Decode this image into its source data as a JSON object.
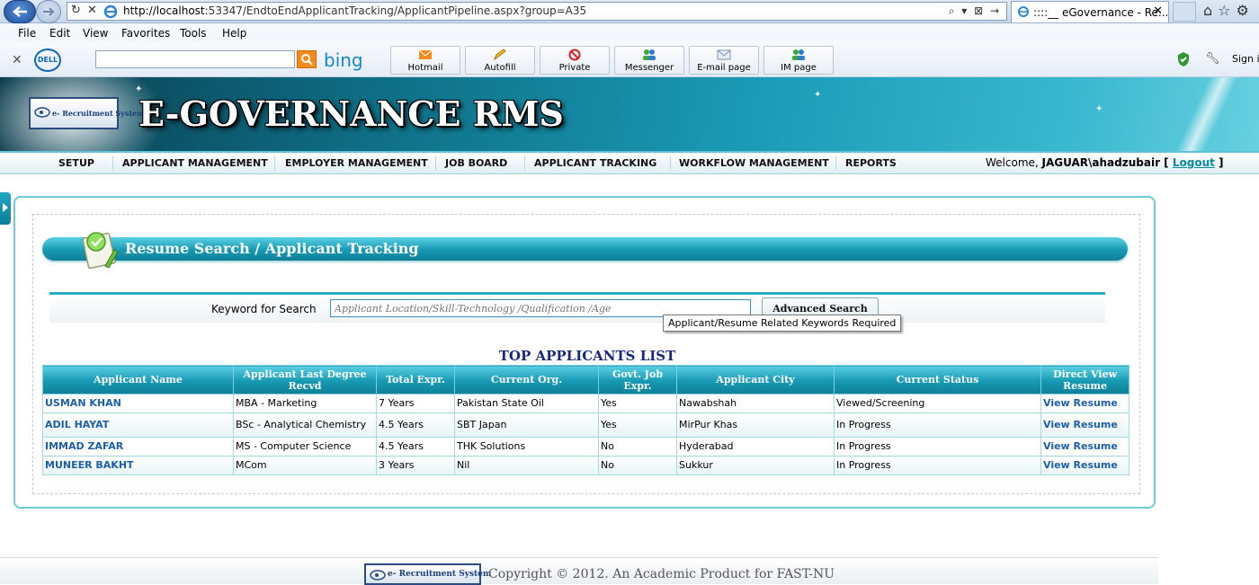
{
  "browser": {
    "url_host": "http://localhost",
    "url_path": ":53347/EndtoEndApplicantTracking/ApplicantPipeline.aspx?group=A35",
    "url_tools": "⌕ ▾ ⊠ →",
    "tab_title": "::::__ eGovernance - Re...",
    "tab_close": "✕",
    "menu": [
      "File",
      "Edit",
      "View",
      "Favorites",
      "Tools",
      "Help"
    ],
    "toolbar_close": "✕",
    "dell_label": "DELL",
    "bing_label": "bing",
    "toolbar_buttons": [
      "Hotmail",
      "Autofill",
      "Private",
      "Messenger",
      "E-mail page",
      "IM page"
    ],
    "sign_in": "Sign i"
  },
  "header": {
    "logo_text": "e- Recruitment System",
    "title": "E-GOVERNANCE RMS"
  },
  "nav": {
    "items": [
      "SETUP",
      "APPLICANT MANAGEMENT",
      "EMPLOYER MANAGEMENT",
      "JOB BOARD",
      "APPLICANT TRACKING",
      "WORKFLOW MANAGEMENT",
      "REPORTS"
    ],
    "welcome_prefix": "Welcome, ",
    "user": "JAGUAR\\ahadzubair",
    "bracket_open": " [ ",
    "logout": "Logout",
    "bracket_close": " ]"
  },
  "search": {
    "banner_title": "Resume Search / Applicant Tracking",
    "label": "Keyword for Search",
    "placeholder": "Applicant Location/Skill-Technology /Qualification /Age",
    "button": "Advanced Search",
    "tooltip": "Applicant/Resume Related Keywords Required"
  },
  "table": {
    "title": "TOP APPLICANTS LIST",
    "headers": [
      "Applicant Name",
      "Applicant Last Degree Recvd",
      "Total Expr.",
      "Current Org.",
      "Govt. Job Expr.",
      "Applicant City",
      "Current Status",
      "Direct View Resume"
    ],
    "rows": [
      [
        "USMAN KHAN",
        "MBA - Marketing",
        "7 Years",
        "Pakistan State Oil",
        "Yes",
        "Nawabshah",
        "Viewed/Screening",
        "View Resume"
      ],
      [
        "ADIL HAYAT",
        "BSc - Analytical Chemistry",
        "4.5 Years",
        "SBT Japan",
        "Yes",
        "MirPur Khas",
        "In Progress",
        "View Resume"
      ],
      [
        "IMMAD ZAFAR",
        "MS - Computer Science",
        "4.5 Years",
        "THK Solutions",
        "No",
        "Hyderabad",
        "In Progress",
        "View Resume"
      ],
      [
        "MUNEER BAKHT",
        "MCom",
        "3 Years",
        "Nil",
        "No",
        "Sukkur",
        "In Progress",
        "View Resume"
      ]
    ]
  },
  "footer": {
    "logo_text": "e- Recruitment System",
    "copyright": "Copyright © 2012. An Academic Product for FAST-NU"
  },
  "colors": {
    "accent": "#1799b3",
    "link": "#1d5fa7",
    "title_navy": "#1a2a7a"
  }
}
